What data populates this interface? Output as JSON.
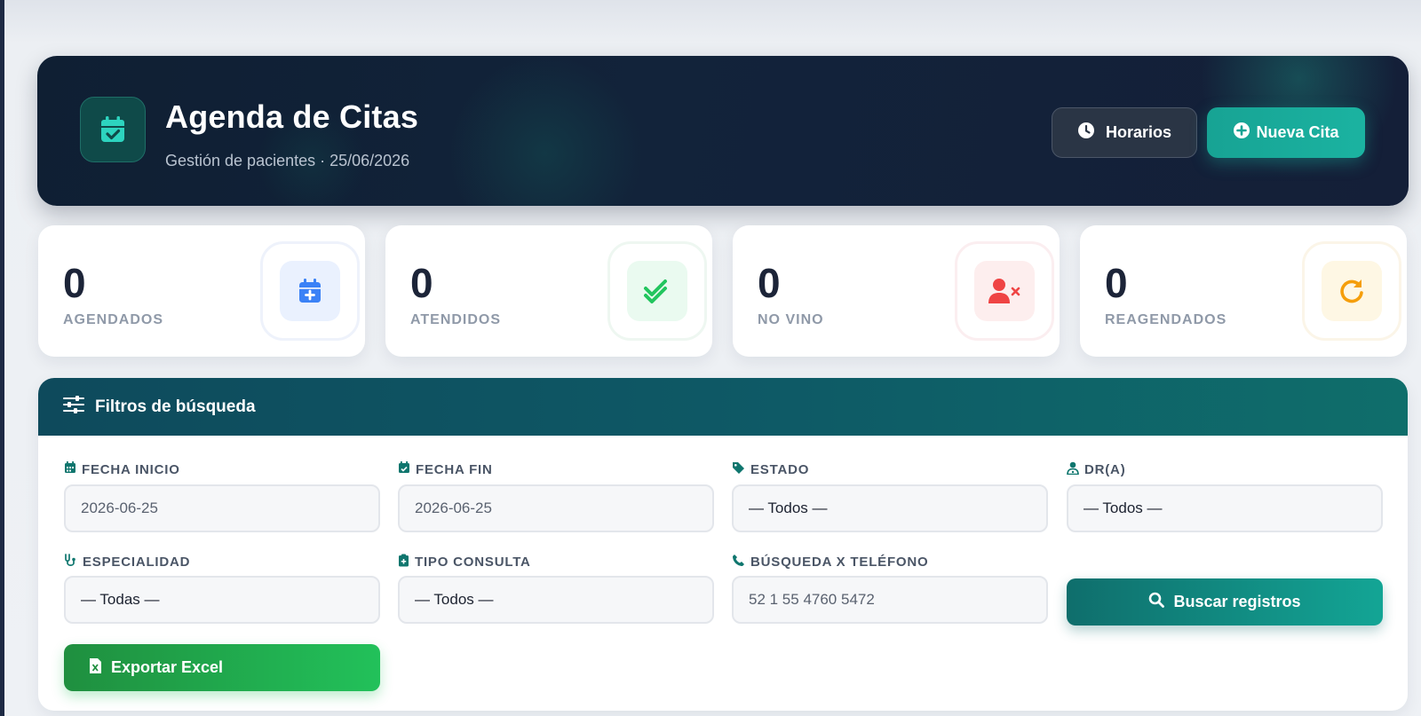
{
  "header": {
    "title": "Agenda de Citas",
    "subtitle": "Gestión de pacientes · 25/06/2026",
    "icon": "calendar-check-icon",
    "buttons": {
      "horarios": "Horarios",
      "nueva_cita": "Nueva Cita"
    }
  },
  "stats": [
    {
      "value": "0",
      "label": "AGENDADOS",
      "icon": "calendar-plus-icon",
      "color": "#3b82f6"
    },
    {
      "value": "0",
      "label": "ATENDIDOS",
      "icon": "double-check-icon",
      "color": "#22c55e"
    },
    {
      "value": "0",
      "label": "NO VINO",
      "icon": "user-x-icon",
      "color": "#ef4444"
    },
    {
      "value": "0",
      "label": "REAGENDADOS",
      "icon": "redo-icon",
      "color": "#f59e0b"
    }
  ],
  "filters": {
    "title": "Filtros de búsqueda",
    "fields": {
      "fecha_inicio": {
        "label": "FECHA INICIO",
        "value": "2026-06-25"
      },
      "fecha_fin": {
        "label": "FECHA FIN",
        "value": "2026-06-25"
      },
      "estado": {
        "label": "ESTADO",
        "value": "— Todos —"
      },
      "doctor": {
        "label": "DR(A)",
        "value": "— Todos —"
      },
      "especialidad": {
        "label": "ESPECIALIDAD",
        "value": "— Todas —"
      },
      "tipo_consulta": {
        "label": "TIPO CONSULTA",
        "value": "— Todos —"
      },
      "telefono": {
        "label": "BÚSQUEDA X TELÉFONO",
        "value": "52 1 55 4760 5472"
      }
    },
    "buttons": {
      "buscar": "Buscar registros",
      "exportar": "Exportar Excel"
    }
  },
  "colors": {
    "accent": "#1bb3a1",
    "header_bg": "#12233a",
    "filter_header": "#0e5a66",
    "excel_green": "#22c15a"
  }
}
